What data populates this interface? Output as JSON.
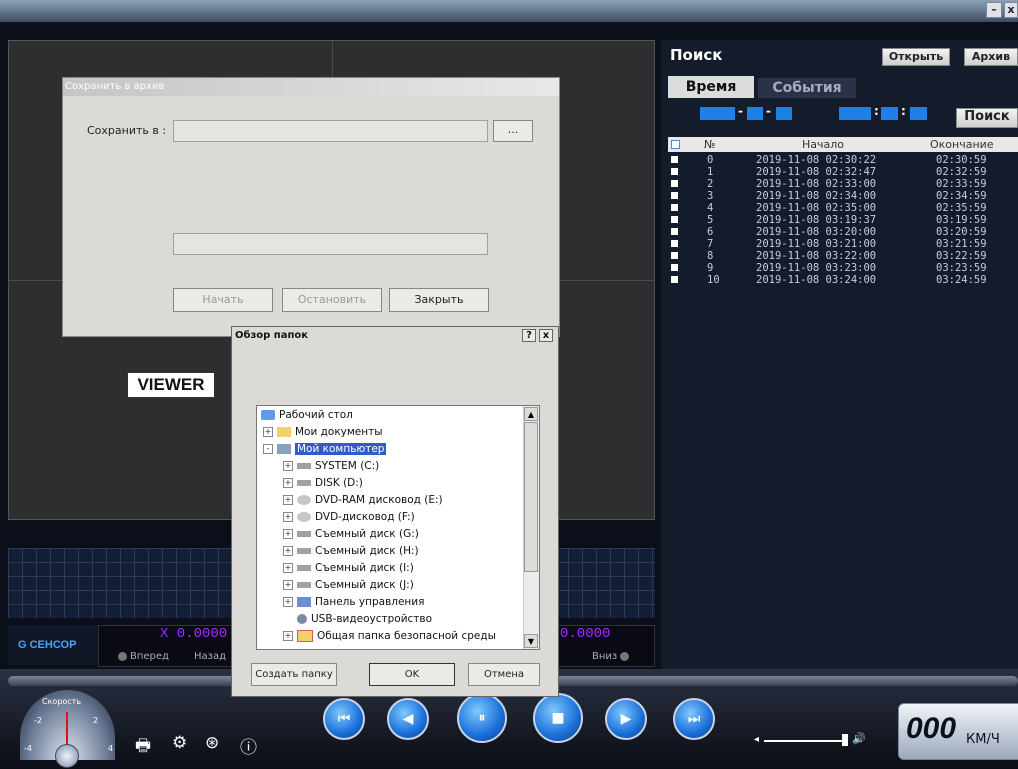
{
  "window": {
    "minimize_label": "–",
    "close_label": "x"
  },
  "viewer_label": "VIEWER",
  "sensor": {
    "title": "G СЕНСОР",
    "x_value": "X 0.0000",
    "z_value": "0.0000",
    "forward": "Вперед",
    "back": "Назад",
    "down": "Вниз"
  },
  "search": {
    "title": "Поиск",
    "open_button": "Открыть",
    "archive_button": "Архив",
    "tab_time": "Время",
    "tab_events": "События",
    "date_sep": "-",
    "time_sep": ":",
    "search_button": "Поиск",
    "columns": [
      "№",
      "Начало",
      "Окончание"
    ],
    "rows": [
      {
        "n": "0",
        "start": "2019-11-08 02:30:22",
        "end": "02:30:59"
      },
      {
        "n": "1",
        "start": "2019-11-08 02:32:47",
        "end": "02:32:59"
      },
      {
        "n": "2",
        "start": "2019-11-08 02:33:00",
        "end": "02:33:59"
      },
      {
        "n": "3",
        "start": "2019-11-08 02:34:00",
        "end": "02:34:59"
      },
      {
        "n": "4",
        "start": "2019-11-08 02:35:00",
        "end": "02:35:59"
      },
      {
        "n": "5",
        "start": "2019-11-08 03:19:37",
        "end": "03:19:59"
      },
      {
        "n": "6",
        "start": "2019-11-08 03:20:00",
        "end": "03:20:59"
      },
      {
        "n": "7",
        "start": "2019-11-08 03:21:00",
        "end": "03:21:59"
      },
      {
        "n": "8",
        "start": "2019-11-08 03:22:00",
        "end": "03:22:59"
      },
      {
        "n": "9",
        "start": "2019-11-08 03:23:00",
        "end": "03:23:59"
      },
      {
        "n": "10",
        "start": "2019-11-08 03:24:00",
        "end": "03:24:59"
      }
    ]
  },
  "archive_dialog": {
    "title": "Сохранить в архив",
    "save_in_label": "Сохранить в :",
    "browse_label": "...",
    "start_button": "Начать",
    "stop_button": "Остановить",
    "close_button": "Закрыть"
  },
  "folder_dialog": {
    "title": "Обзор папок",
    "help_label": "?",
    "close_label": "x",
    "tree": [
      {
        "label": "Рабочий стол"
      },
      {
        "label": "Мои документы"
      },
      {
        "label": "Мой компьютер"
      },
      {
        "label": "SYSTEM (C:)"
      },
      {
        "label": "DISK (D:)"
      },
      {
        "label": "DVD-RAM дисковод (E:)"
      },
      {
        "label": "DVD-дисковод (F:)"
      },
      {
        "label": "Съемный диск (G:)"
      },
      {
        "label": "Съемный диск (H:)"
      },
      {
        "label": "Съемный диск (I:)"
      },
      {
        "label": "Съемный диск (J:)"
      },
      {
        "label": "Панель управления"
      },
      {
        "label": "USB-видеоустройство"
      },
      {
        "label": "Общая папка безопасной среды"
      }
    ],
    "new_folder_button": "Создать папку",
    "ok_button": "OK",
    "cancel_button": "Отмена"
  },
  "speedometer": {
    "title": "Скорость",
    "ticks": [
      "-2",
      "2",
      "-4",
      "4"
    ],
    "value": "000",
    "unit": "КМ/Ч"
  },
  "colors": {
    "accent_blue": "#1e7fe6",
    "sensor_value": "#a12bff",
    "selection": "#2e5dc8"
  }
}
